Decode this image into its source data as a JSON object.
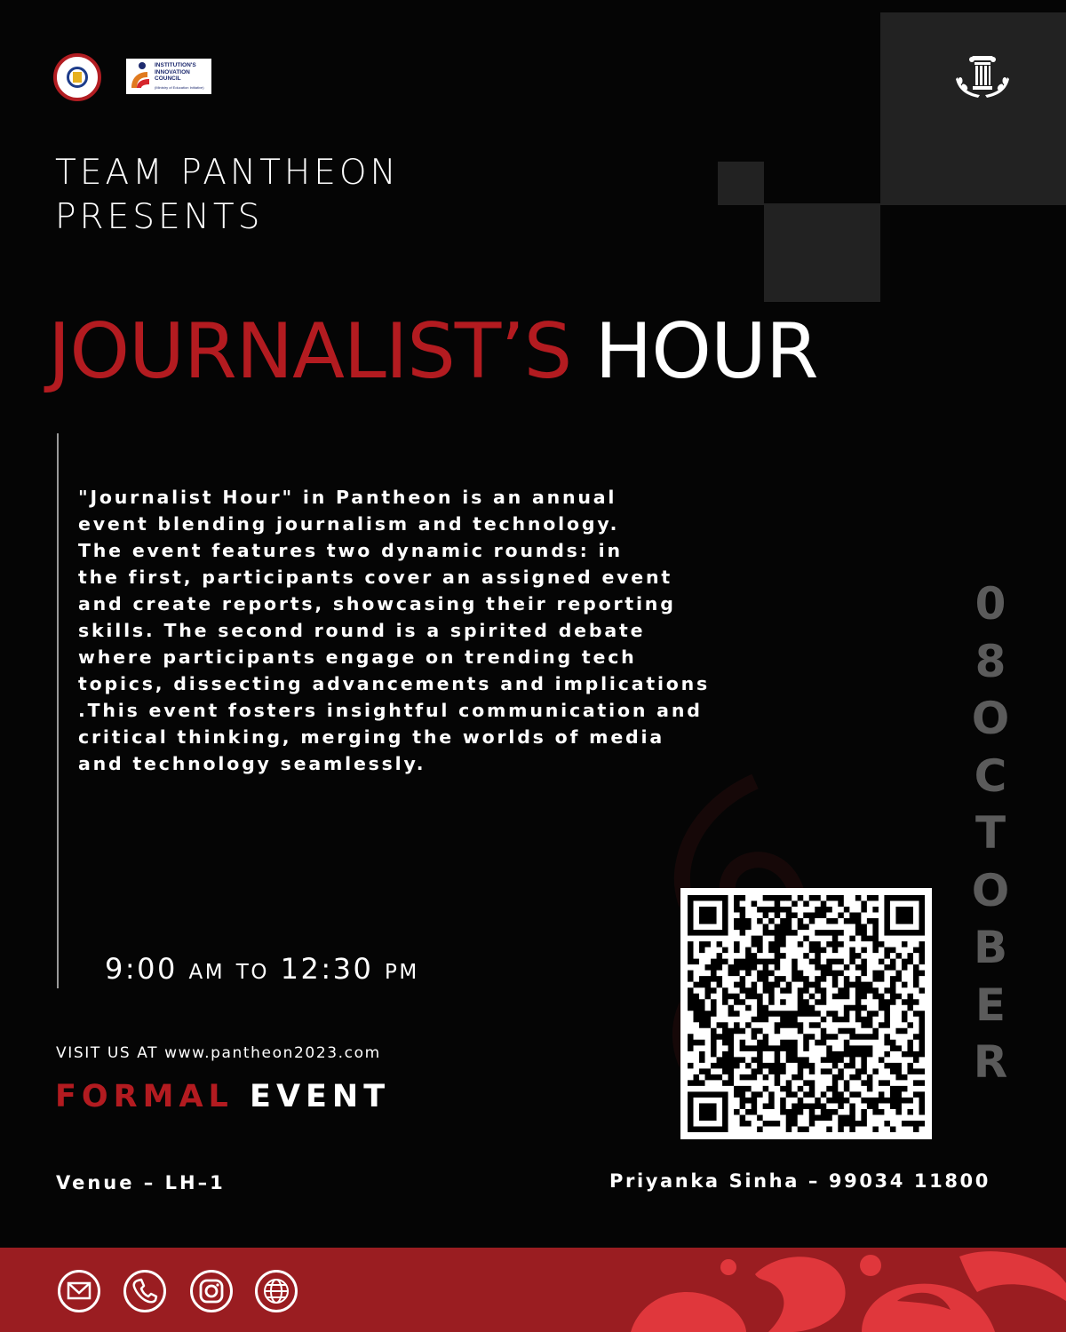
{
  "logos": {
    "iic_line1": "INSTITUTION'S",
    "iic_line2": "INNOVATION",
    "iic_line3": "COUNCIL",
    "iic_sub": "(Ministry of Education Initiative)"
  },
  "header": {
    "presents_line1": "TEAM PANTHEON",
    "presents_line2": "PRESENTS",
    "title_red": "JOURNALIST’S",
    "title_white": "HOUR"
  },
  "description": "\"Journalist Hour\" in Pantheon is an annual\nevent blending journalism and technology.\nThe event features two dynamic rounds: in\nthe first, participants cover an assigned event\nand create reports, showcasing their reporting\nskills. The second round is a spirited debate\nwhere participants engage on trending tech\ntopics, dissecting advancements and implications\n.This event fosters insightful communication and\ncritical thinking, merging the worlds of media\nand technology seamlessly.",
  "time": {
    "start": "9:00",
    "start_suffix": "AM",
    "to": "TO",
    "end": "12:30",
    "end_suffix": "PM"
  },
  "visit": "VISIT US AT www.pantheon2023.com",
  "event_type": {
    "red": "FORMAL",
    "white": "EVENT"
  },
  "venue": "Venue – LH–1",
  "contact": "Priyanka Sinha – 99034 11800",
  "date": {
    "day_digits": [
      "0",
      "8"
    ],
    "month_letters": [
      "O",
      "C",
      "T",
      "O",
      "B",
      "E",
      "R"
    ]
  },
  "colors": {
    "accent_red": "#b31b20",
    "footer_red": "#9a1d21",
    "date_gray": "#5b5b5b",
    "square_gray": "#222222",
    "background": "#050505"
  },
  "footer_icons": [
    "mail-icon",
    "phone-icon",
    "instagram-icon",
    "globe-icon"
  ]
}
